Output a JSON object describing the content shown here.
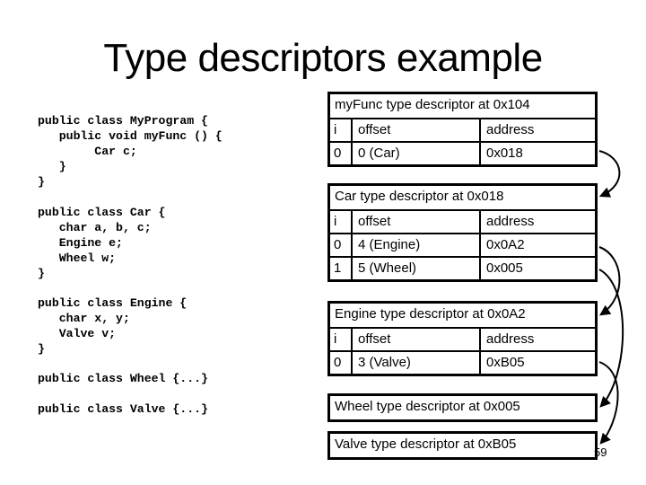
{
  "slide": {
    "title": "Type descriptors example",
    "page_number": "59"
  },
  "code": {
    "myprogram": "public class MyProgram {\n   public void myFunc () {\n        Car c;\n   }\n}",
    "car": "public class Car {\n   char a, b, c;\n   Engine e;\n   Wheel w;\n}",
    "engine": "public class Engine {\n   char x, y;\n   Valve v;\n}",
    "wheel": "public class Wheel {...}",
    "valve": "public class Valve {...}"
  },
  "descriptors": {
    "myfunc": {
      "title": "myFunc type descriptor at 0x104",
      "columns": [
        "i",
        "offset",
        "address"
      ],
      "rows": [
        {
          "i": "0",
          "offset": "0 (Car)",
          "address": "0x018"
        }
      ]
    },
    "car": {
      "title": "Car type descriptor at 0x018",
      "columns": [
        "i",
        "offset",
        "address"
      ],
      "rows": [
        {
          "i": "0",
          "offset": "4 (Engine)",
          "address": "0x0A2"
        },
        {
          "i": "1",
          "offset": "5 (Wheel)",
          "address": "0x005"
        }
      ]
    },
    "engine": {
      "title": "Engine type descriptor at 0x0A2",
      "columns": [
        "i",
        "offset",
        "address"
      ],
      "rows": [
        {
          "i": "0",
          "offset": "3 (Valve)",
          "address": "0xB05"
        }
      ]
    },
    "wheel": {
      "title": "Wheel type descriptor at 0x005"
    },
    "valve": {
      "title": "Valve type descriptor at 0xB05"
    }
  },
  "pointers": [
    {
      "from": "myfunc.row0",
      "to": "car"
    },
    {
      "from": "car.row0",
      "to": "engine"
    },
    {
      "from": "car.row1",
      "to": "wheel"
    },
    {
      "from": "engine.row0",
      "to": "valve"
    }
  ]
}
